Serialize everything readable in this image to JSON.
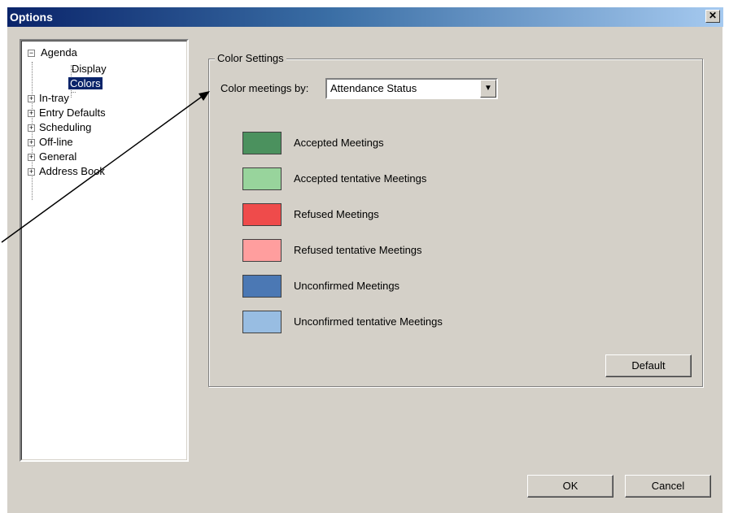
{
  "window": {
    "title": "Options",
    "close_symbol": "✕"
  },
  "tree": {
    "items": [
      {
        "label": "Agenda",
        "expander": "−"
      },
      {
        "label": "Display"
      },
      {
        "label": "Colors",
        "selected": true
      },
      {
        "label": "In-tray",
        "expander": "+"
      },
      {
        "label": "Entry Defaults",
        "expander": "+"
      },
      {
        "label": "Scheduling",
        "expander": "+"
      },
      {
        "label": "Off-line",
        "expander": "+"
      },
      {
        "label": "General",
        "expander": "+"
      },
      {
        "label": "Address Book",
        "expander": "+"
      }
    ]
  },
  "color_settings": {
    "legend": "Color Settings",
    "combo_label": "Color meetings by:",
    "combo_value": "Attendance Status",
    "combo_arrow": "▼",
    "items": [
      {
        "label": "Accepted Meetings",
        "color": "#4b915e"
      },
      {
        "label": "Accepted tentative Meetings",
        "color": "#98d49c"
      },
      {
        "label": "Refused Meetings",
        "color": "#ef4b4b"
      },
      {
        "label": "Refused tentative Meetings",
        "color": "#ff9e9e"
      },
      {
        "label": "Unconfirmed Meetings",
        "color": "#4b78b4"
      },
      {
        "label": "Unconfirmed tentative Meetings",
        "color": "#98bde2"
      }
    ],
    "default_button": "Default"
  },
  "footer": {
    "ok_button": "OK",
    "cancel_button": "Cancel"
  },
  "colors": {
    "selection": "#0a246a",
    "face": "#d4d0c8"
  }
}
